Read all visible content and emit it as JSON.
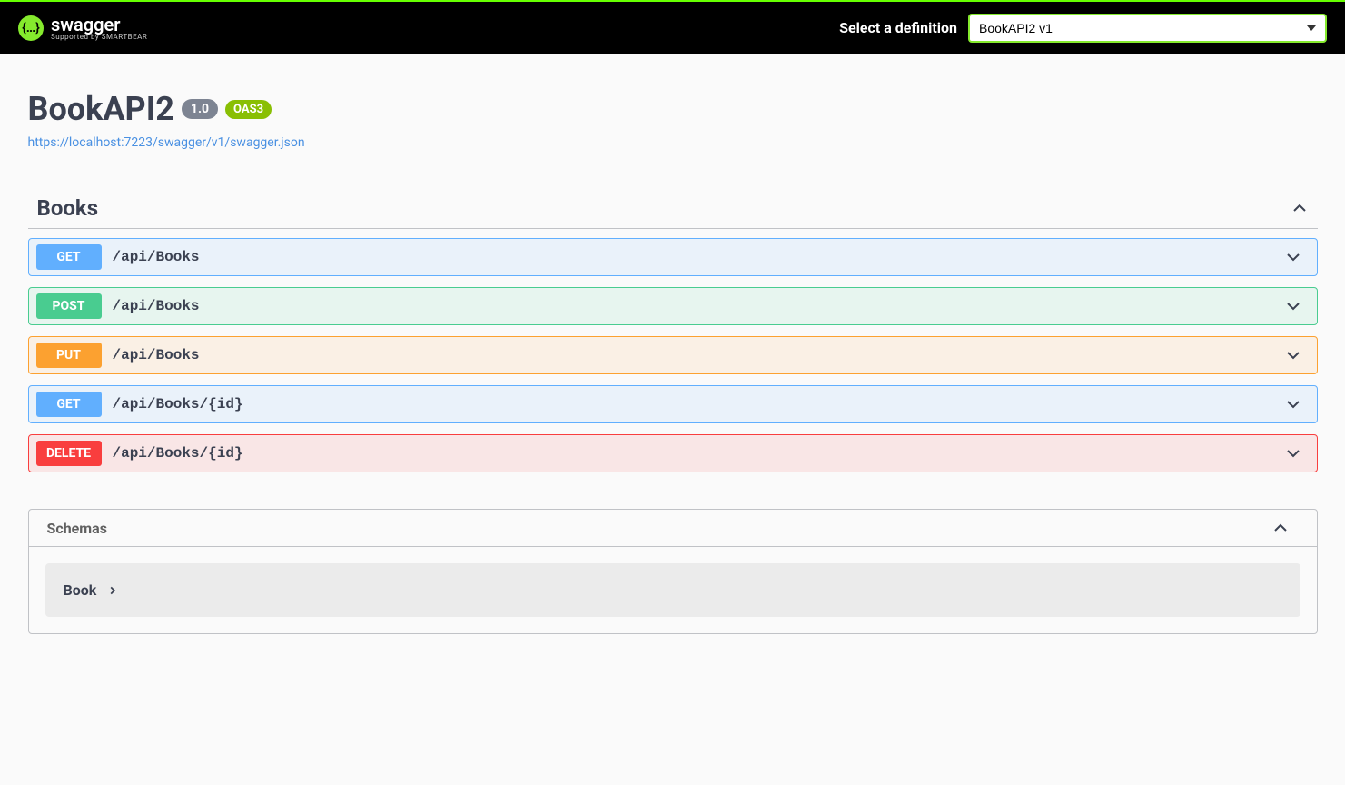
{
  "topbar": {
    "brand_title": "swagger",
    "brand_sub": "Supported by SMARTBEAR",
    "select_label": "Select a definition",
    "definition_options": [
      "BookAPI2 v1"
    ],
    "definition_selected": "BookAPI2 v1"
  },
  "info": {
    "title": "BookAPI2",
    "version": "1.0",
    "oas": "OAS3",
    "spec_url": "https://localhost:7223/swagger/v1/swagger.json"
  },
  "tag": {
    "name": "Books",
    "operations": [
      {
        "method": "GET",
        "path": "/api/Books"
      },
      {
        "method": "POST",
        "path": "/api/Books"
      },
      {
        "method": "PUT",
        "path": "/api/Books"
      },
      {
        "method": "GET",
        "path": "/api/Books/{id}"
      },
      {
        "method": "DELETE",
        "path": "/api/Books/{id}"
      }
    ]
  },
  "schemas": {
    "title": "Schemas",
    "items": [
      "Book"
    ]
  }
}
